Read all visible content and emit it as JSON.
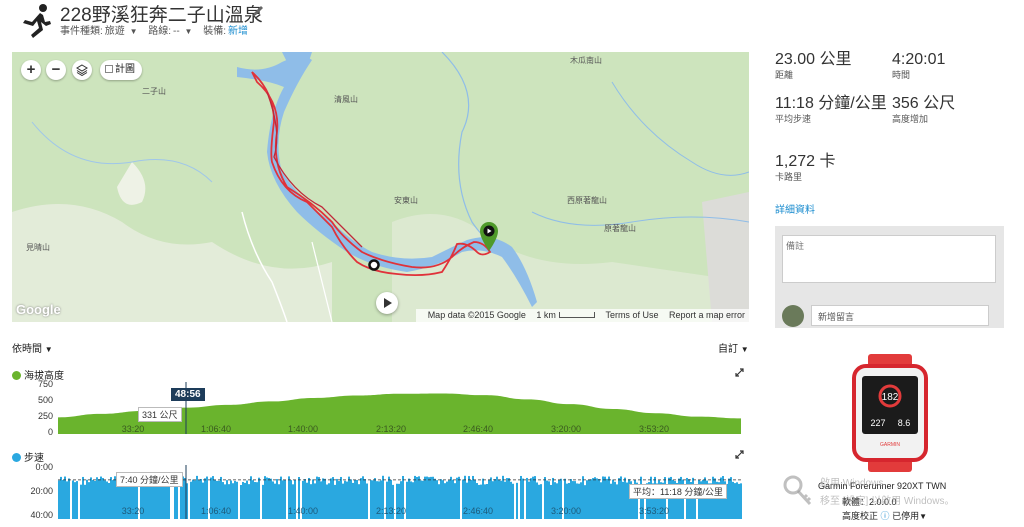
{
  "activity": {
    "title": "228野溪狂奔二子山溫泉",
    "event_type_label": "事件種類:",
    "event_type_value": "旅遊",
    "course_label": "路線:",
    "course_value": "--",
    "gear_label": "裝備:",
    "gear_value": "新增"
  },
  "map": {
    "terrain_label": "計圖",
    "labels": {
      "erzishan": "二子山",
      "qingpinshan": "清風山",
      "anguoshan": "安東山",
      "jianqingshan": "見晴山",
      "mugualiushan": "木瓜南山",
      "xiyuanzhushan": "西原著龍山",
      "yuanzhushan": "原著龍山"
    },
    "google_logo": "Google",
    "attribution": "Map data ©2015 Google",
    "scale": "1 km",
    "terms": "Terms of Use",
    "report": "Report a map error"
  },
  "charts": {
    "x_axis_mode": "依時間",
    "customize": "自訂",
    "cursor_time": "48:56",
    "elevation": {
      "label": "海拔高度",
      "color": "#6ab42d",
      "tooltip": "331 公尺"
    },
    "pace": {
      "label": "步速",
      "color": "#2aa8e0",
      "tooltip": "7:40 分鐘/公里",
      "average": "平均：11:18 分鐘/公里"
    }
  },
  "chart_data": [
    {
      "type": "area",
      "title": "海拔高度",
      "x": [
        "33:20",
        "1:06:40",
        "1:40:00",
        "2:13:20",
        "2:46:40",
        "3:20:00",
        "3:53:20"
      ],
      "y_ticks": [
        "750",
        "500",
        "250",
        "0"
      ],
      "ylim": [
        0,
        750
      ],
      "series": [
        {
          "name": "海拔高度",
          "values": [
            240,
            290,
            331,
            380,
            420,
            470,
            520,
            555,
            580,
            585,
            560,
            500,
            430,
            360,
            300,
            250,
            225
          ]
        }
      ],
      "x_range_s": [
        0,
        16200
      ]
    },
    {
      "type": "bar",
      "title": "步速",
      "x": [
        "33:20",
        "1:06:40",
        "1:40:00",
        "2:13:20",
        "2:46:40",
        "3:20:00",
        "3:53:20"
      ],
      "y_ticks": [
        "0:00",
        "20:00",
        "40:00"
      ],
      "ylim": [
        0,
        40
      ],
      "average": "11:18"
    }
  ],
  "stats": {
    "distance_value": "23.00 公里",
    "distance_label": "距離",
    "time_value": "4:20:01",
    "time_label": "時間",
    "pace_value": "11:18 分鐘/公里",
    "pace_label": "平均步速",
    "elev_value": "356 公尺",
    "elev_label": "高度增加",
    "cal_value": "1,272 卡",
    "cal_label": "卡路里",
    "details_link": "詳細資料"
  },
  "comments": {
    "note_placeholder": "備註",
    "new_comment_placeholder": "新增留言"
  },
  "device": {
    "name": "Garmin Forerunner 920XT TWN",
    "version_label": "軟體：",
    "version_value": "2.0.0.0",
    "altimeter_label": "高度校正",
    "altimeter_value": "已停用"
  },
  "watermark": {
    "line1": "啟用 Windows",
    "line2": "移至 [設定] 以啟用 Windows。"
  }
}
